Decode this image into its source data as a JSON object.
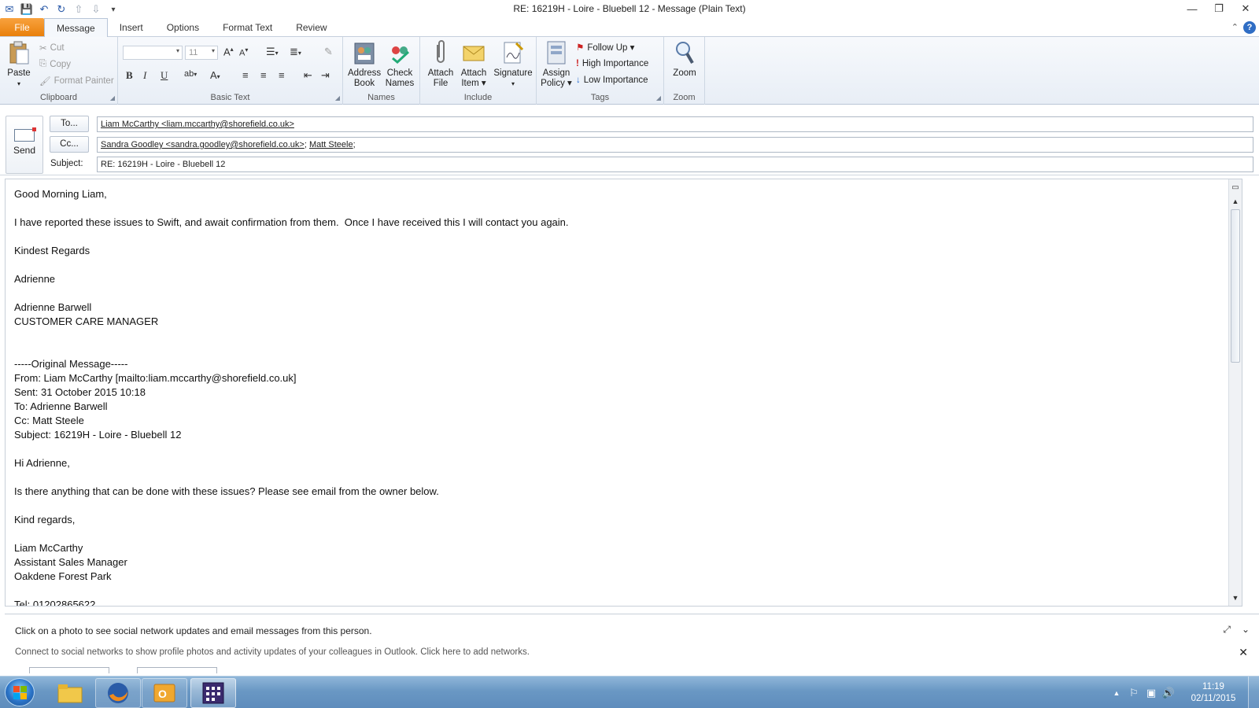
{
  "window": {
    "title": "RE: 16219H - Loire - Bluebell 12  -  Message (Plain Text)"
  },
  "ribbon": {
    "tabs": [
      "File",
      "Message",
      "Insert",
      "Options",
      "Format Text",
      "Review"
    ],
    "active_tab": "Message",
    "clipboard": {
      "label": "Clipboard",
      "paste": "Paste",
      "cut": "Cut",
      "copy": "Copy",
      "format_painter": "Format Painter"
    },
    "basic_text": {
      "label": "Basic Text",
      "font_size": "11"
    },
    "names": {
      "label": "Names",
      "address_book_1": "Address",
      "address_book_2": "Book",
      "check_names_1": "Check",
      "check_names_2": "Names"
    },
    "include": {
      "label": "Include",
      "attach_file_1": "Attach",
      "attach_file_2": "File",
      "attach_item_1": "Attach",
      "attach_item_2": "Item ▾",
      "signature": "Signature"
    },
    "tags": {
      "label": "Tags",
      "assign_policy_1": "Assign",
      "assign_policy_2": "Policy ▾",
      "follow_up": "Follow Up ▾",
      "high_importance": "High Importance",
      "low_importance": "Low Importance"
    },
    "zoom": {
      "label": "Zoom",
      "zoom": "Zoom"
    }
  },
  "header": {
    "send": "Send",
    "to_button": "To...",
    "cc_button": "Cc...",
    "subject_label": "Subject:",
    "to_value": "Liam McCarthy <liam.mccarthy@shorefield.co.uk>",
    "cc_value_1": "Sandra Goodley <sandra.goodley@shorefield.co.uk>",
    "cc_sep": "; ",
    "cc_value_2": "Matt Steele",
    "cc_trail": ";",
    "subject_value": "RE: 16219H - Loire - Bluebell 12"
  },
  "body": {
    "lines": [
      "Good Morning Liam,",
      "",
      "I have reported these issues to Swift, and await confirmation from them.  Once I have received this I will contact you again.",
      "",
      "Kindest Regards",
      "",
      "Adrienne",
      "",
      "Adrienne Barwell",
      "CUSTOMER CARE MANAGER",
      "",
      "",
      "-----Original Message-----",
      "From: Liam McCarthy [mailto:liam.mccarthy@shorefield.co.uk]",
      "Sent: 31 October 2015 10:18",
      "To: Adrienne Barwell",
      "Cc: Matt Steele",
      "Subject: 16219H - Loire - Bluebell 12",
      "",
      "Hi Adrienne,",
      "",
      "Is there anything that can be done with these issues? Please see email from the owner below.",
      "",
      "Kind regards,",
      "",
      "Liam McCarthy",
      "Assistant Sales Manager",
      "Oakdene Forest Park",
      "",
      "Tel: 01202865622"
    ]
  },
  "people_pane": {
    "message": "Click on a photo to see social network updates and email messages from this person.",
    "connect": "Connect to social networks to show profile photos and activity updates of your colleagues in Outlook. Click here to add networks."
  },
  "taskbar": {
    "time": "11:19",
    "date": "02/11/2015"
  },
  "colors": {
    "file_tab": "#e9800b",
    "taskbar": "#6a98c4",
    "accent": "#2f6dc4"
  }
}
